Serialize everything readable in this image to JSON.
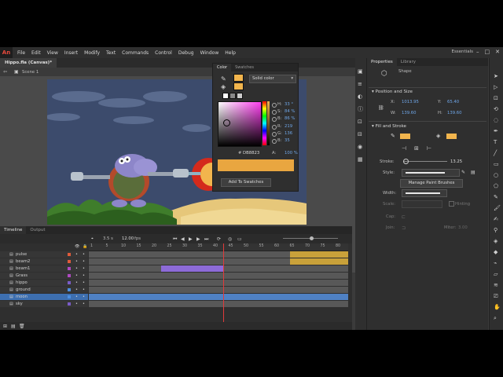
{
  "app": {
    "logo": "An",
    "menu": [
      "File",
      "Edit",
      "View",
      "Insert",
      "Modify",
      "Text",
      "Commands",
      "Control",
      "Debug",
      "Window",
      "Help"
    ],
    "workspace": "Essentials",
    "window_buttons": [
      "–",
      "□",
      "✕"
    ]
  },
  "document": {
    "tab": "Hippo.fla (Canvas)*",
    "scene": "Scene 1"
  },
  "color_panel": {
    "tabs": [
      "Color",
      "Swatches"
    ],
    "fill_type": "Solid color",
    "hsb": [
      {
        "label": "H:",
        "value": "33 °"
      },
      {
        "label": "S:",
        "value": "84 %"
      },
      {
        "label": "B:",
        "value": "86 %"
      }
    ],
    "rgb": [
      {
        "label": "R:",
        "value": "219"
      },
      {
        "label": "G:",
        "value": "136"
      },
      {
        "label": "B:",
        "value": "35"
      }
    ],
    "alpha": {
      "label": "A:",
      "value": "100 %"
    },
    "hex_label": "#",
    "hex": "DB8823",
    "add_swatch": "Add To Swatches",
    "fill_color": "#f2b54d"
  },
  "timeline": {
    "tabs": [
      "Timeline",
      "Output"
    ],
    "fps": "12.00",
    "fps_unit": "fps",
    "current_frame": "3.5 s",
    "ruler": [
      "1",
      "5",
      "10",
      "15",
      "20",
      "25",
      "30",
      "35",
      "40",
      "45",
      "50",
      "55",
      "60",
      "65",
      "70",
      "75",
      "80"
    ],
    "layers": [
      {
        "name": "pulse",
        "color": "#e05b3a"
      },
      {
        "name": "beam2",
        "color": "#e05b3a"
      },
      {
        "name": "beam1",
        "color": "#b04ac2"
      },
      {
        "name": "Grass",
        "color": "#b04ac2"
      },
      {
        "name": "hippo",
        "color": "#7a5cc7"
      },
      {
        "name": "ground",
        "color": "#4a8ee0"
      },
      {
        "name": "moon",
        "color": "#4a8ee0",
        "selected": true
      },
      {
        "name": "sky",
        "color": "#7a5cc7"
      }
    ]
  },
  "properties": {
    "tabs": [
      "Properties",
      "Library"
    ],
    "object_type": "Shape",
    "position_section": "Position and Size",
    "x_label": "X:",
    "x_value": "1013.95",
    "y_label": "Y:",
    "y_value": "65.40",
    "w_label": "W:",
    "w_value": "139.60",
    "h_label": "H:",
    "h_value": "139.60",
    "fill_section": "Fill and Stroke",
    "stroke_label": "Stroke:",
    "stroke_value": "13.25",
    "style_label": "Style:",
    "manage_brushes": "Manage Paint Brushes",
    "width_label": "Width:",
    "scale_label": "Scale:",
    "hinting_label": "Hinting",
    "cap_label": "Cap:",
    "join_label": "Join:",
    "miter_label": "Miter:",
    "miter_value": "3.00",
    "stroke_color": "#f2b54d",
    "fill_color": "#f2b54d"
  }
}
